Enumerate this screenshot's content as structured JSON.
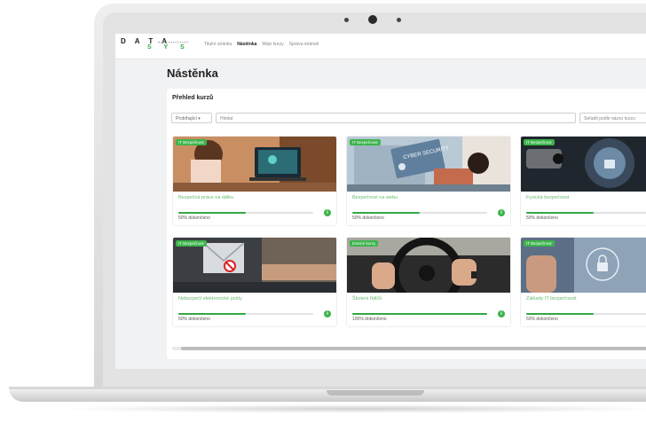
{
  "app": {
    "logo_top": "D A T A",
    "logo_bottom": "S Y S",
    "nav": [
      "Titulní stránka",
      "Nástěnka",
      "Moje kurzy",
      "Správa stránek"
    ],
    "page_title": "Nástěnka"
  },
  "panel": {
    "title": "Přehled kurzů",
    "filter_value": "Probíhající",
    "filter_caret": "▾",
    "search_placeholder": "Hledat",
    "sort_value": "Seřadit podle názvu kurzu"
  },
  "courses": [
    {
      "badge": "IT Bezpečnost",
      "title": "Bezpečná práce na dálku",
      "progress_text": "50% dokončeno",
      "progress": 0.5,
      "info": "i"
    },
    {
      "badge": "IT Bezpečnost",
      "title": "Bezpečnost na webu",
      "progress_text": "50% dokončeno",
      "progress": 0.5,
      "info": "i"
    },
    {
      "badge": "IT Bezpečnost",
      "title": "Fyzická bezpečnost",
      "progress_text": "50% dokončeno",
      "progress": 0.5,
      "info": "i"
    },
    {
      "badge": "IT Bezpečnost",
      "title": "Nebezpečí elektronické pošty",
      "progress_text": "50% dokončeno",
      "progress": 0.5,
      "info": "i"
    },
    {
      "badge": "Externí kurzy",
      "title": "Školení řidičů",
      "progress_text": "100% dokončeno",
      "progress": 1.0,
      "info": "i"
    },
    {
      "badge": "IT Bezpečnost",
      "title": "Základy IT bezpečnosti",
      "progress_text": "50% dokončeno",
      "progress": 0.5,
      "info": "i"
    }
  ],
  "image_text": {
    "cyber_sign": "CYBER SECURITY"
  },
  "colors": {
    "accent": "#3cb44b",
    "progress": "#33a845",
    "title_green": "#6cbb73"
  }
}
